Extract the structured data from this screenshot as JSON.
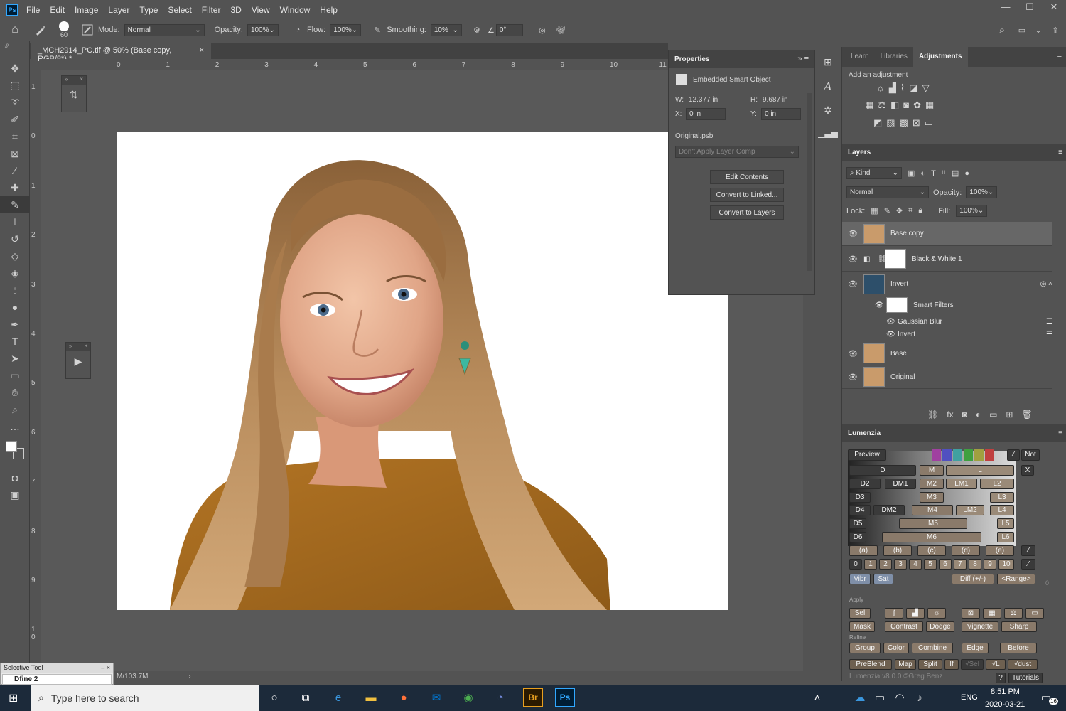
{
  "menu": {
    "app_icon": "Ps",
    "items": [
      "File",
      "Edit",
      "Image",
      "Layer",
      "Type",
      "Select",
      "Filter",
      "3D",
      "View",
      "Window",
      "Help"
    ]
  },
  "window_controls": [
    "—",
    "☐",
    "✕"
  ],
  "options_bar": {
    "brush_size": "60",
    "mode_label": "Mode:",
    "mode_value": "Normal",
    "opacity_label": "Opacity:",
    "opacity_value": "100%",
    "flow_label": "Flow:",
    "flow_value": "100%",
    "smoothing_label": "Smoothing:",
    "smoothing_value": "10%",
    "angle_value": "0°"
  },
  "document": {
    "tab_title": "_MCH2914_PC.tif @ 50% (Base copy, RGB/8*) *",
    "close": "×",
    "status": "M/103.7M"
  },
  "ruler_h": [
    "0",
    "1",
    "2",
    "3",
    "4",
    "5",
    "6",
    "7",
    "8",
    "9",
    "10",
    "11"
  ],
  "ruler_v": [
    "1",
    "0",
    "1",
    "2",
    "3",
    "4",
    "5",
    "6",
    "7",
    "8",
    "9",
    "1 0"
  ],
  "properties": {
    "title": "Properties",
    "type": "Embedded Smart Object",
    "w_label": "W:",
    "w_value": "12.377 in",
    "h_label": "H:",
    "h_value": "9.687 in",
    "x_label": "X:",
    "x_value": "0 in",
    "y_label": "Y:",
    "y_value": "0 in",
    "file": "Original.psb",
    "layer_comp": "Don't Apply Layer Comp",
    "btn_edit": "Edit Contents",
    "btn_linked": "Convert to Linked...",
    "btn_layers": "Convert to Layers"
  },
  "right_tabs": [
    "Learn",
    "Libraries",
    "Adjustments"
  ],
  "adjustments": {
    "hint": "Add an adjustment"
  },
  "layers": {
    "title": "Layers",
    "kind": "Kind",
    "blend": "Normal",
    "opacity_label": "Opacity:",
    "opacity_value": "100%",
    "lock_label": "Lock:",
    "fill_label": "Fill:",
    "fill_value": "100%",
    "items": [
      {
        "name": "Base copy"
      },
      {
        "name": "Black & White 1"
      },
      {
        "name": "Invert"
      },
      {
        "name": "Smart Filters"
      },
      {
        "name": "Gaussian Blur"
      },
      {
        "name": "Invert"
      },
      {
        "name": "Base"
      },
      {
        "name": "Original"
      }
    ]
  },
  "lumenzia": {
    "title": "Lumenzia",
    "preview": "Preview",
    "not": "Not",
    "x": "X",
    "rows": {
      "r1": [
        "D",
        "M",
        "L"
      ],
      "r2": [
        "D2",
        "DM1",
        "M2",
        "LM1",
        "L2"
      ],
      "r3": [
        "D3",
        "M3",
        "L3"
      ],
      "r4": [
        "D4",
        "DM2",
        "M4",
        "LM2",
        "L4"
      ],
      "r5": [
        "D5",
        "M5",
        "L5"
      ],
      "r6": [
        "D6",
        "M6",
        "L6"
      ],
      "zones": [
        "(a)",
        "(b)",
        "(c)",
        "(d)",
        "(e)"
      ],
      "nums": [
        "0",
        "1",
        "2",
        "3",
        "4",
        "5",
        "6",
        "7",
        "8",
        "9",
        "10"
      ],
      "vibr": "Vibr",
      "sat": "Sat",
      "diff": "Diff (+/-)",
      "range": "<Range>",
      "zero": "0"
    },
    "apply_label": "Apply",
    "sel": "Sel",
    "mask": "Mask",
    "contrast": "Contrast",
    "dodge": "Dodge",
    "vignette": "Vignette",
    "sharp": "Sharp",
    "refine_label": "Refine",
    "group": "Group",
    "color": "Color",
    "combine": "Combine",
    "edge": "Edge",
    "before": "Before",
    "preblend": "PreBlend",
    "map": "Map",
    "split": "Split",
    "if": "If",
    "vsel": "√Sel",
    "vl": "√L",
    "vdust": "√dust",
    "credit": "Lumenzia v8.0.0 ©Greg Benz",
    "help": "?",
    "tutorials": "Tutorials"
  },
  "selective_tool": {
    "title": "Selective Tool",
    "value": "Dfine 2"
  },
  "taskbar": {
    "search_placeholder": "Type here to search",
    "lang": "ENG",
    "time": "8:51 PM",
    "date": "2020-03-21",
    "notif": "16"
  }
}
